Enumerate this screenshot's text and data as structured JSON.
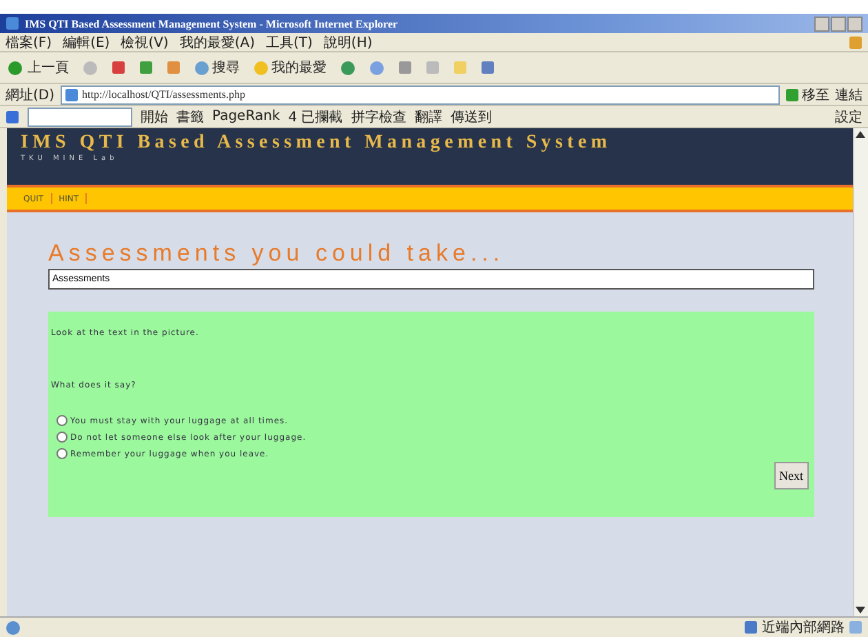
{
  "window": {
    "title": "IMS QTI Based Assessment Management System - Microsoft Internet Explorer"
  },
  "menu": [
    "檔案(F)",
    "編輯(E)",
    "檢視(V)",
    "我的最愛(A)",
    "工具(T)",
    "說明(H)"
  ],
  "toolbar": {
    "back": "上一頁",
    "search": "搜尋",
    "favorites": "我的最愛"
  },
  "address": {
    "label": "網址(D)",
    "url": "http://localhost/QTI/assessments.php",
    "go": "移至",
    "links": "連結"
  },
  "google_toolbar": {
    "items": [
      "開始",
      "書籤",
      "PageRank",
      "4 已攔截",
      "拼字檢查",
      "翻譯",
      "傳送到"
    ],
    "settings": "設定"
  },
  "page": {
    "title": "IMS QTI Based Assessment Management System",
    "subtitle": "TKU MINE Lab",
    "nav": [
      "QUIT",
      "HINT"
    ],
    "heading": "Assessments you could take...",
    "field_value": "Assessments",
    "question": {
      "intro": "Look at the text in the picture.",
      "prompt": "What does it say?",
      "options": [
        {
          "label": "You must stay with your luggage at all times.",
          "selected": false
        },
        {
          "label": "Do not let someone else look after your luggage.",
          "selected": false
        },
        {
          "label": "Remember your luggage when you leave.",
          "selected": false
        }
      ],
      "next": "Next"
    }
  },
  "status_bar": {
    "zone": "近端內部網路"
  }
}
